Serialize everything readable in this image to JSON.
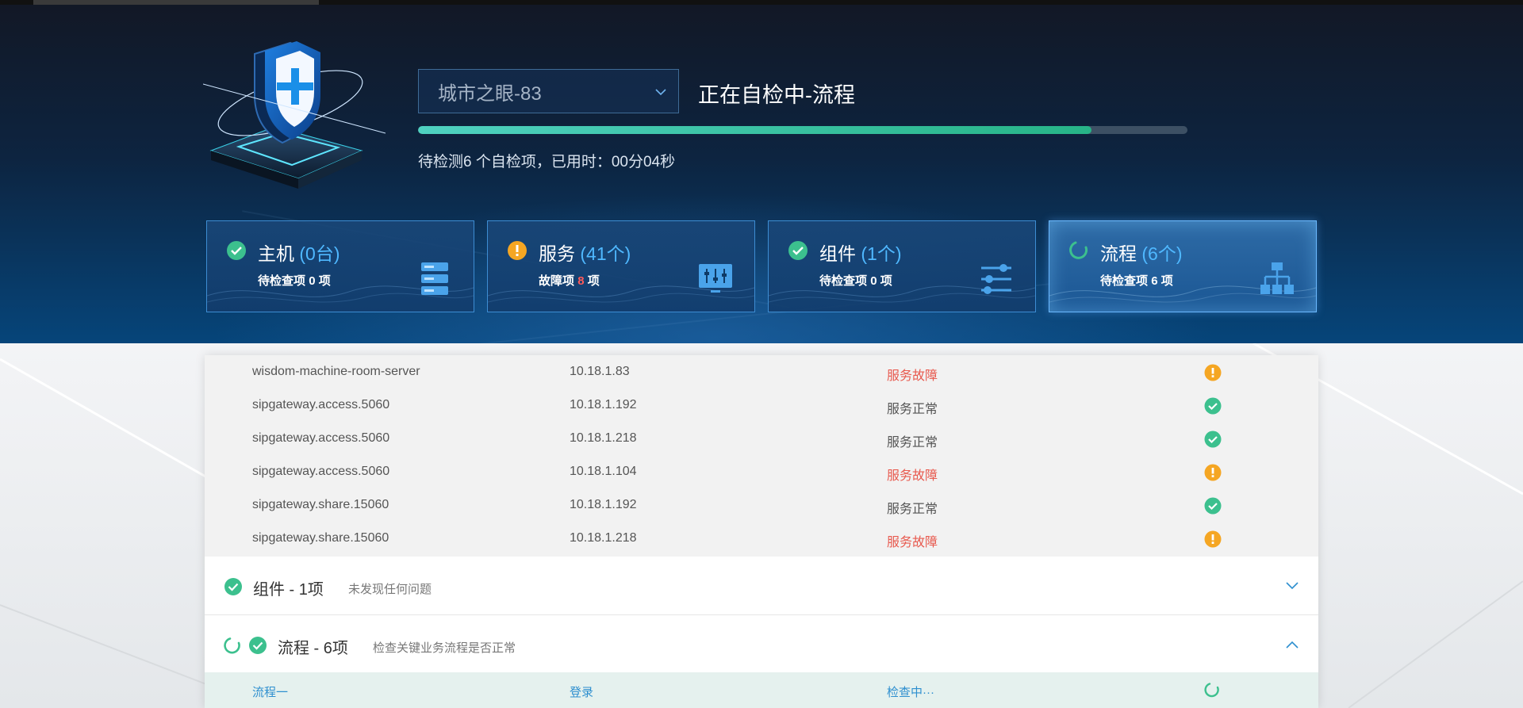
{
  "header": {
    "project_select": {
      "value": "城市之眼-83"
    },
    "status_title": "正在自检中-流程",
    "progress": {
      "percent": 87.5
    },
    "progress_info": "待检测6 个自检项，已用时：00分04秒"
  },
  "cards": [
    {
      "title": "主机",
      "count": "(0台)",
      "sub_prefix": "待检查项",
      "sub_num": "0",
      "sub_suffix": "项",
      "status": "ok",
      "icon": "server-icon"
    },
    {
      "title": "服务",
      "count": "(41个)",
      "sub_prefix": "故障项",
      "sub_num": "8",
      "sub_suffix": "项",
      "status": "warning",
      "icon": "monitor-sliders-icon"
    },
    {
      "title": "组件",
      "count": "(1个)",
      "sub_prefix": "待检查项",
      "sub_num": "0",
      "sub_suffix": "项",
      "status": "ok",
      "icon": "sliders-icon"
    },
    {
      "title": "流程",
      "count": "(6个)",
      "sub_prefix": "待检查项",
      "sub_num": "6",
      "sub_suffix": "项",
      "status": "loading",
      "icon": "flowchart-icon"
    }
  ],
  "services": [
    {
      "name": "wisdom-machine-room-server",
      "ip": "10.18.1.83",
      "status": "服务故障",
      "state": "fault"
    },
    {
      "name": "sipgateway.access.5060",
      "ip": "10.18.1.192",
      "status": "服务正常",
      "state": "ok"
    },
    {
      "name": "sipgateway.access.5060",
      "ip": "10.18.1.218",
      "status": "服务正常",
      "state": "ok"
    },
    {
      "name": "sipgateway.access.5060",
      "ip": "10.18.1.104",
      "status": "服务故障",
      "state": "fault"
    },
    {
      "name": "sipgateway.share.15060",
      "ip": "10.18.1.192",
      "status": "服务正常",
      "state": "ok"
    },
    {
      "name": "sipgateway.share.15060",
      "ip": "10.18.1.218",
      "status": "服务故障",
      "state": "fault"
    }
  ],
  "sections": {
    "components": {
      "title": "组件  -  1项",
      "desc": "未发现任何问题"
    },
    "flows": {
      "title": "流程  -  6项",
      "desc": "检查关键业务流程是否正常"
    }
  },
  "flow_row": {
    "name": "流程一",
    "action": "登录",
    "status": "检查中···"
  },
  "colors": {
    "accent": "#4fb8ff",
    "ok": "#3cc08e",
    "warning": "#f5a623",
    "fault_text": "#e85a4f"
  }
}
